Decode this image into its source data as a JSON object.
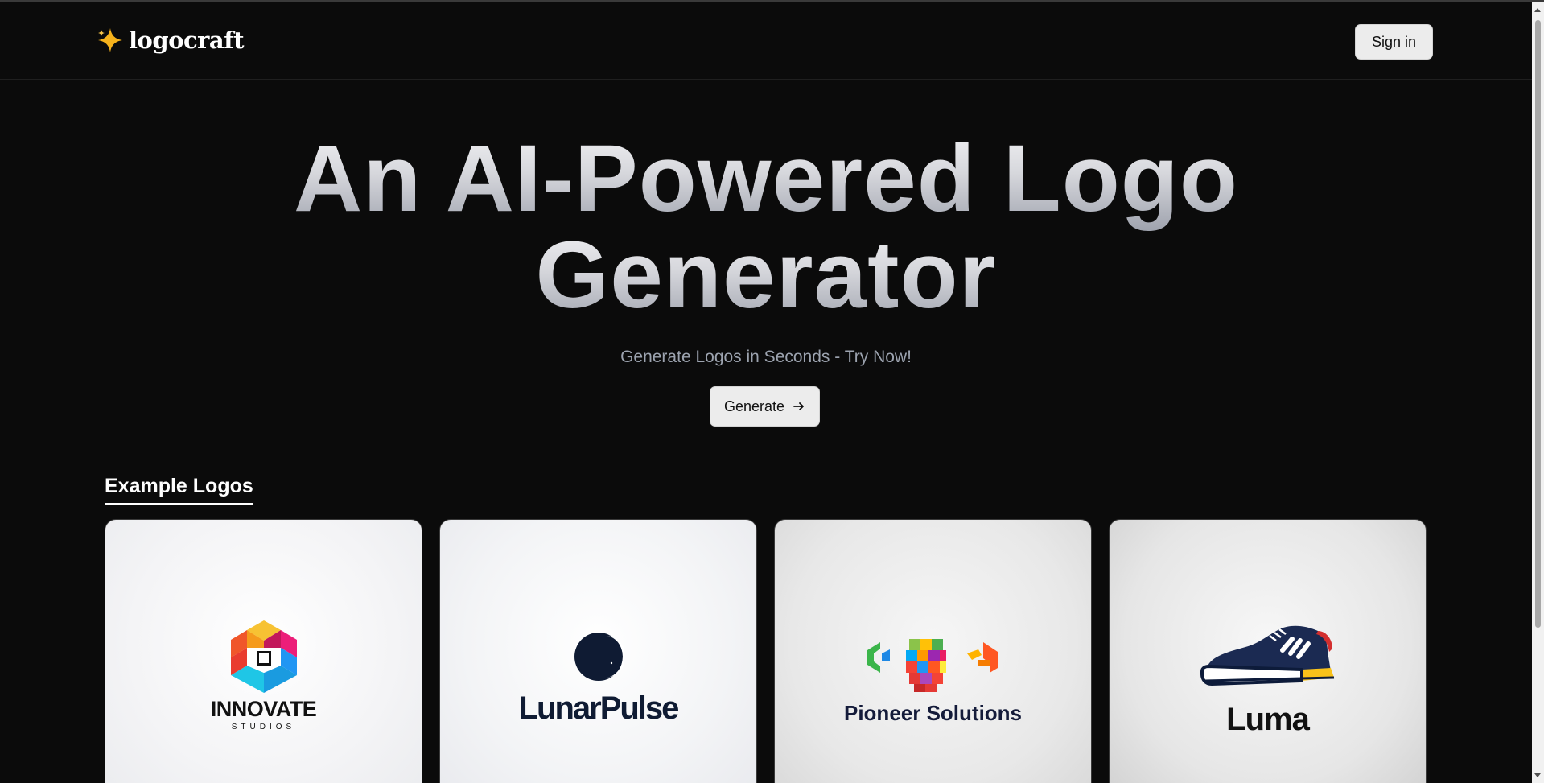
{
  "brand": {
    "name": "logocraft",
    "icon": "sparkle-icon",
    "icon_color": "#f5b21c"
  },
  "header": {
    "signin_label": "Sign in"
  },
  "hero": {
    "title_line1": "An AI-Powered Logo",
    "title_line2": "Generator",
    "subtitle": "Generate Logos in Seconds - Try Now!",
    "cta_label": "Generate",
    "cta_icon": "arrow-right-icon"
  },
  "examples": {
    "title": "Example Logos",
    "cards": [
      {
        "name": "INNOVATE",
        "sub": "STUDIOS",
        "icon": "colorful-hexagon-icon"
      },
      {
        "name": "LunarPulse",
        "icon": "crescent-moon-icon"
      },
      {
        "name": "Pioneer Solutions",
        "icon": "colorful-cubes-icon"
      },
      {
        "name": "Luma",
        "icon": "sneaker-icon"
      }
    ]
  },
  "colors": {
    "background": "#0b0b0b",
    "button_bg": "#ececec",
    "subtitle": "#9ca3af"
  }
}
